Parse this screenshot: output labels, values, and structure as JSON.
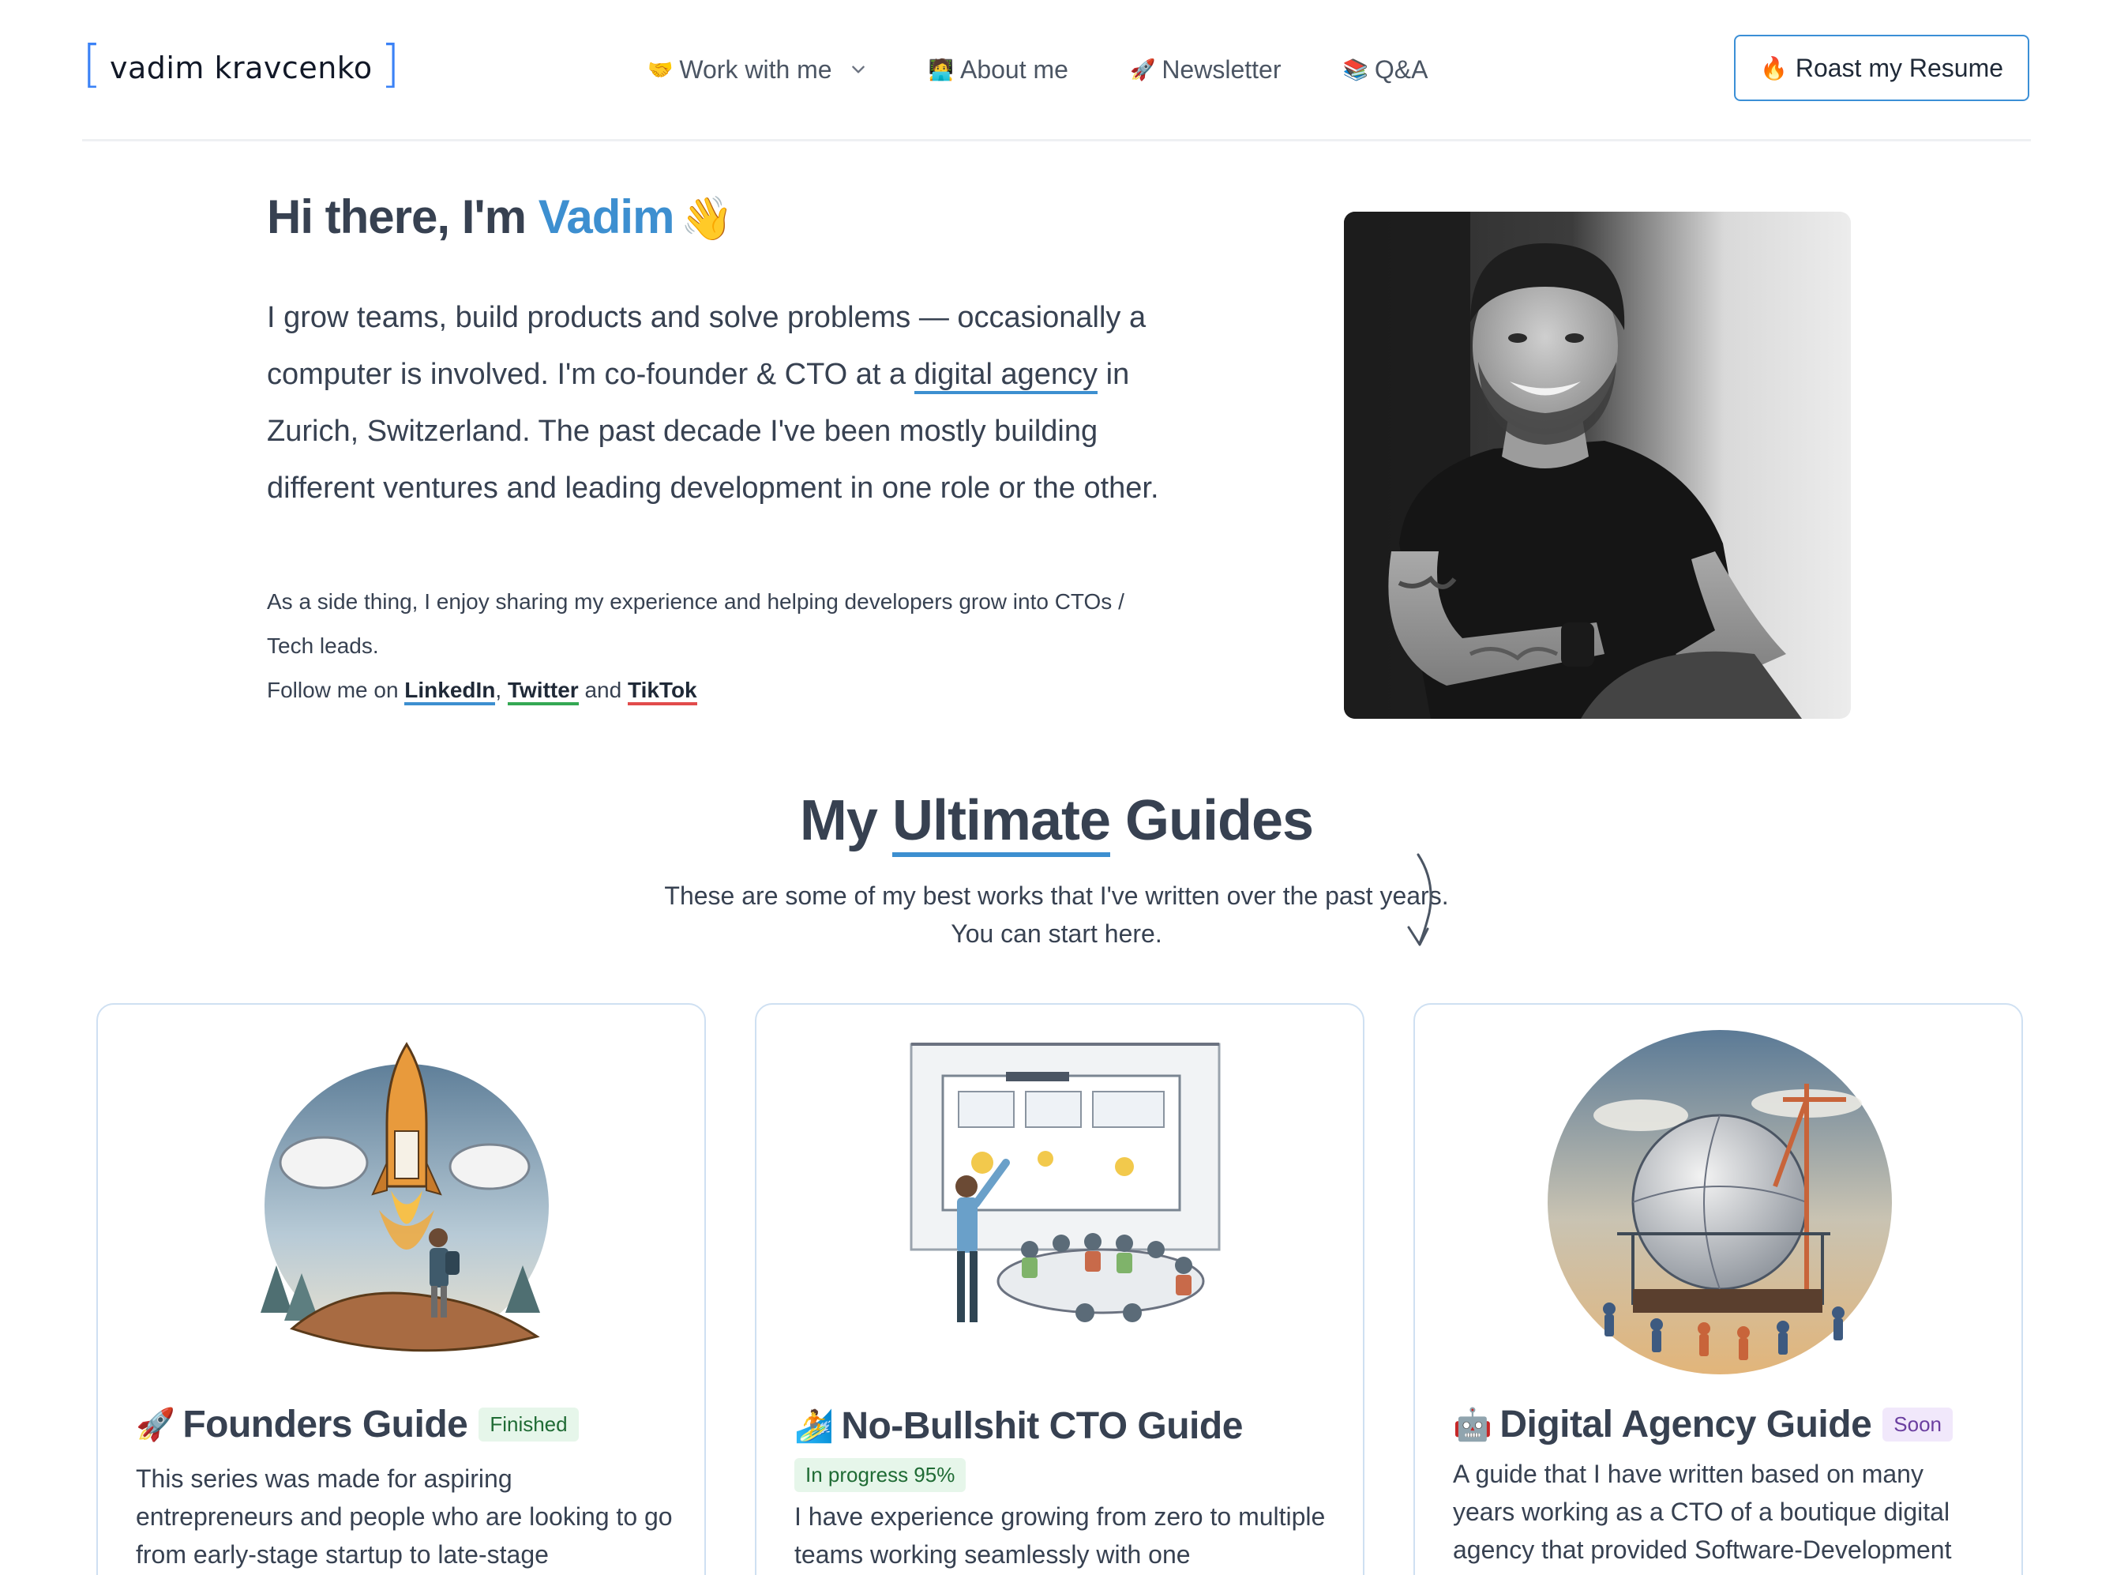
{
  "header": {
    "logo_text": "vadim kravcenko",
    "nav": [
      {
        "emoji": "🤝",
        "label": "Work with me",
        "has_dropdown": true
      },
      {
        "emoji": "🧑‍💻",
        "label": "About me"
      },
      {
        "emoji": "🚀",
        "label": "Newsletter"
      },
      {
        "emoji": "📚",
        "label": "Q&A"
      }
    ],
    "cta": {
      "emoji": "🔥",
      "label": "Roast my Resume"
    }
  },
  "hero": {
    "title_prefix": "Hi there, I'm ",
    "title_name": "Vadim",
    "title_emoji": "👋",
    "lead_before_link": "I grow teams, build products and solve problems — occasionally a computer is involved. I'm co-founder & CTO at a ",
    "lead_link": "digital agency",
    "lead_after_link": " in Zurich, Switzerland. The past decade I've been mostly building different ventures and leading development in one role or the other.",
    "side_text": "As a side thing, I enjoy sharing my experience and helping developers grow into CTOs / Tech leads.",
    "follow_prefix": "Follow me on ",
    "links": [
      "LinkedIn",
      "Twitter",
      "TikTok"
    ],
    "sep_comma": ", ",
    "sep_and": " and "
  },
  "guides": {
    "title_prefix": "My ",
    "title_highlight": "Ultimate",
    "title_suffix": " Guides",
    "subtitle": "These are some of my best works that I've written over the past years. You can start here.",
    "cards": [
      {
        "emoji": "🚀",
        "title": "Founders Guide",
        "badge": "Finished",
        "text": "This series was made for aspiring entrepreneurs and people who are looking to go from early-stage startup to late-stage"
      },
      {
        "emoji": "🏄",
        "title": "No-Bullshit CTO Guide",
        "badge": "In progress 95%",
        "progress_percent": 95,
        "text": "I have experience growing from zero to multiple teams working seamlessly with one"
      },
      {
        "emoji": "🤖",
        "title": "Digital Agency Guide",
        "badge": "Soon",
        "text": "A guide that I have written based on many years working as a CTO of a boutique digital agency that provided Software-Development"
      }
    ]
  },
  "colors": {
    "accent_blue": "#3d8fd0",
    "linkedin_underline": "#3d8fd0",
    "twitter_underline": "#34a853",
    "tiktok_underline": "#e24b4b",
    "badge_green_bg": "#e6f6ea",
    "badge_purple_bg": "#f1e8fb",
    "card_border": "#cfe0f2"
  }
}
